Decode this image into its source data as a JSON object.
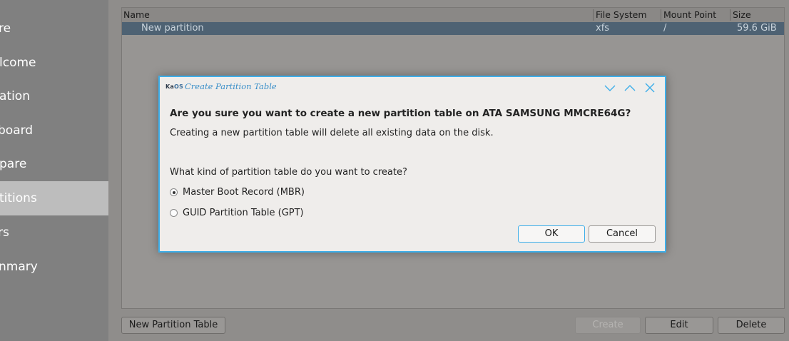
{
  "sidebar": {
    "items": [
      {
        "label": "re",
        "active": false
      },
      {
        "label": "lcome",
        "active": false
      },
      {
        "label": "ation",
        "active": false
      },
      {
        "label": "board",
        "active": false
      },
      {
        "label": "pare",
        "active": false
      },
      {
        "label": "titions",
        "active": true
      },
      {
        "label": "rs",
        "active": false
      },
      {
        "label": "nmary",
        "active": false
      }
    ]
  },
  "table": {
    "headers": {
      "name": "Name",
      "file_system": "File System",
      "mount_point": "Mount Point",
      "size": "Size"
    },
    "rows": [
      {
        "name": "New partition",
        "file_system": "xfs",
        "mount_point": "/",
        "size": "59.6 GiB"
      }
    ]
  },
  "bottom_bar": {
    "new_partition_table": "New Partition Table",
    "create": "Create",
    "edit": "Edit",
    "delete": "Delete"
  },
  "dialog": {
    "logo_text": "Ka",
    "logo_os": "OS",
    "title": "Create Partition Table",
    "heading": "Are you sure you want to create a new partition table on ATA SAMSUNG MMCRE64G?",
    "warning": "Creating a new partition table will delete all existing data on the disk.",
    "question": "What kind of partition table do you want to create?",
    "options": [
      {
        "label": "Master Boot Record (MBR)",
        "checked": true
      },
      {
        "label": "GUID Partition Table (GPT)",
        "checked": false
      }
    ],
    "ok_label": "OK",
    "cancel_label": "Cancel"
  },
  "colors": {
    "accent": "#3daee9",
    "selection": "#4e6273",
    "sidebar_bg": "#808080"
  }
}
